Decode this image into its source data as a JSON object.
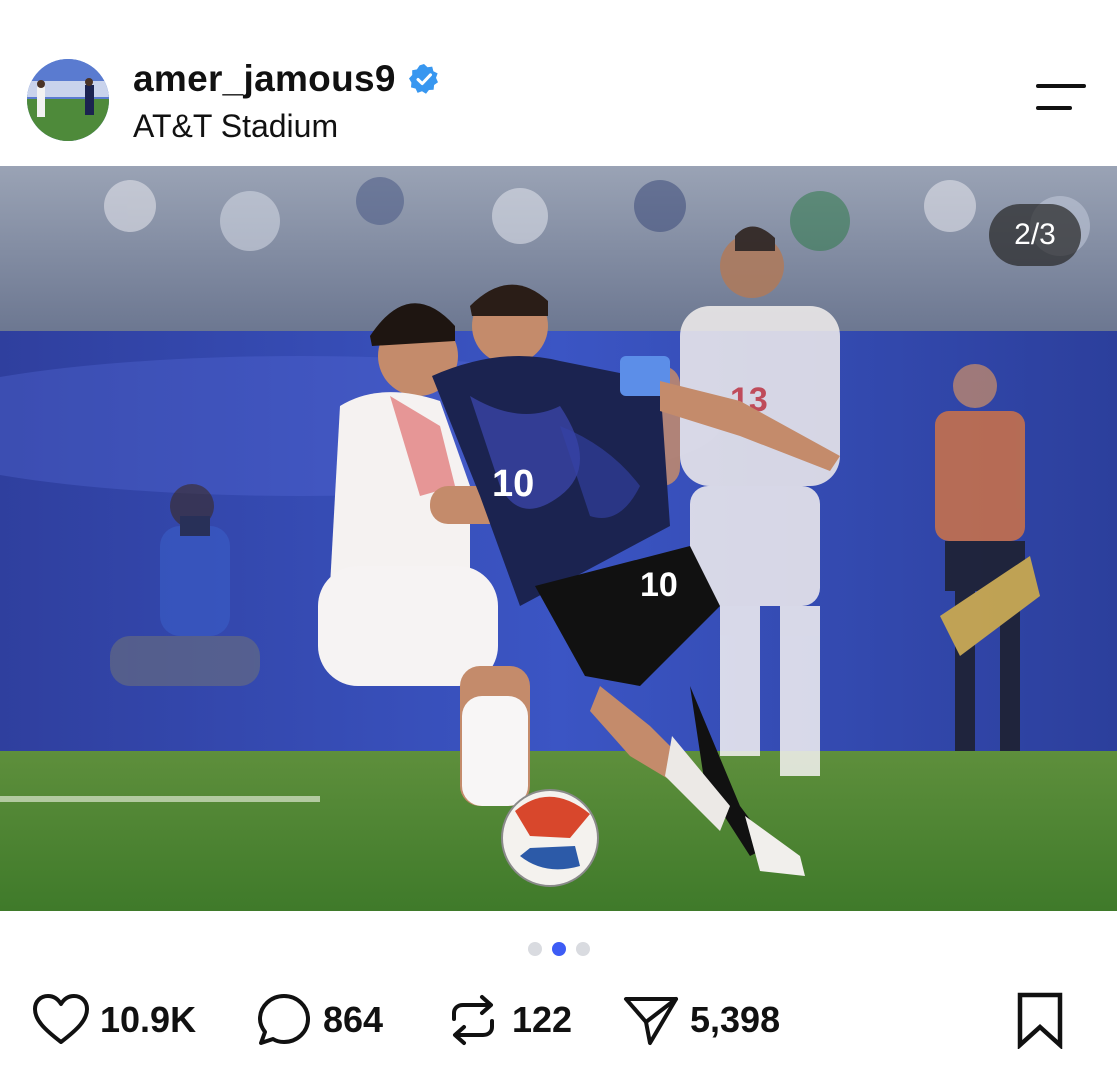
{
  "post": {
    "username": "amer_jamous9",
    "verified": true,
    "location": "AT&T Stadium",
    "photo_counter": "2/3",
    "carousel": {
      "total": 3,
      "active_index": 1
    }
  },
  "actions": {
    "likes": "10.9K",
    "comments": "864",
    "reposts": "122",
    "shares": "5,398"
  },
  "icons": {
    "verified": "verified-badge-icon",
    "menu": "menu-icon",
    "like": "heart-icon",
    "comment": "comment-icon",
    "repost": "repost-icon",
    "share": "send-icon",
    "save": "bookmark-icon"
  },
  "colors": {
    "verified_blue": "#3897f0",
    "active_dot": "#3d5cf5",
    "inactive_dot": "#d9dbe0"
  }
}
